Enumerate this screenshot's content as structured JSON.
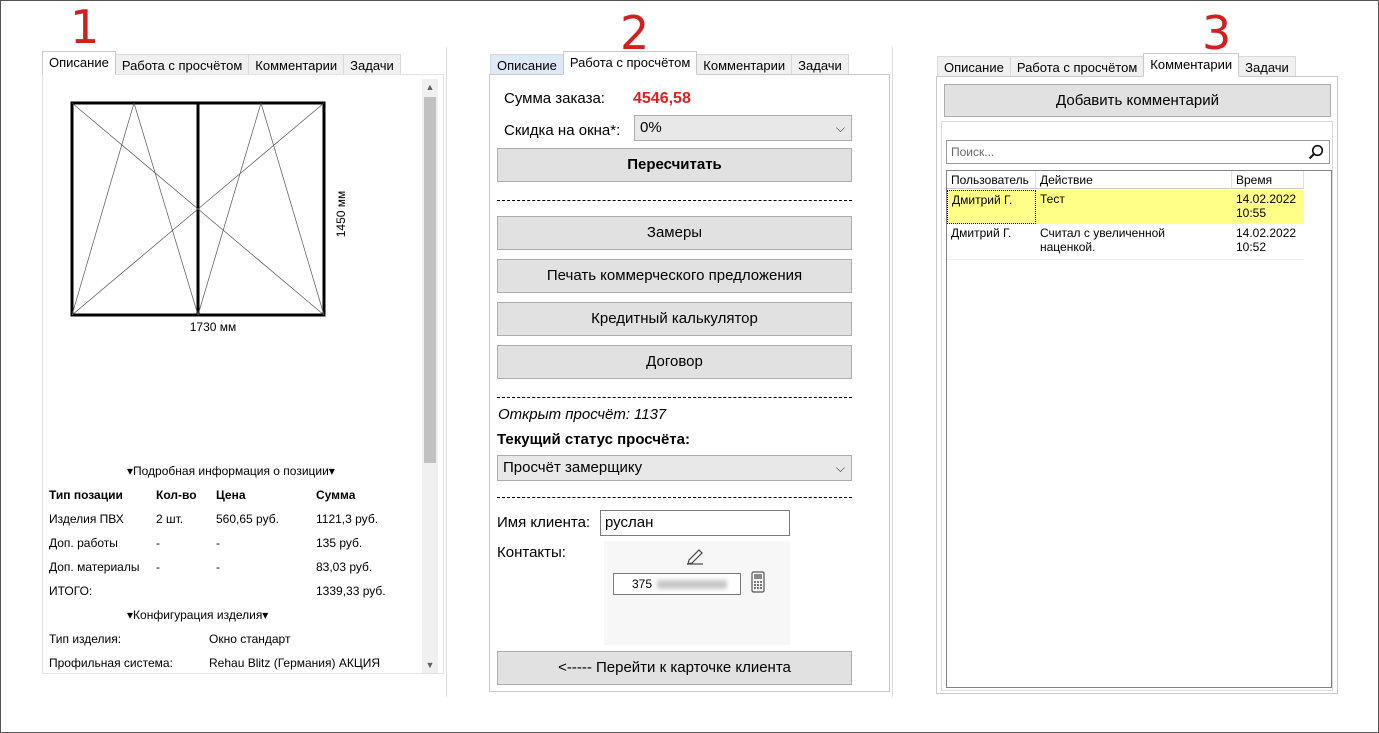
{
  "labels": {
    "one": "1",
    "two": "2",
    "three": "3"
  },
  "colors": {
    "accent": "#d21f1f",
    "selected_row": "#ffff88",
    "tab_blue": "#dde9f6"
  },
  "panel1": {
    "tabs": [
      "Описание",
      "Работа с просчётом",
      "Комментарии",
      "Задачи"
    ],
    "active_tab": 0,
    "drawing": {
      "height_label": "1450 мм",
      "width_label": "1730 мм"
    },
    "detail_header": "▾Подробная информация о позиции▾",
    "table_headers": [
      "Тип позации",
      "Кол-во",
      "Цена",
      "Сумма"
    ],
    "table_rows": [
      [
        "Изделия ПВХ",
        "2 шт.",
        "560,65 руб.",
        "1121,3 руб."
      ],
      [
        "Доп. работы",
        "-",
        "-",
        "135 руб."
      ],
      [
        "Доп. материалы",
        "-",
        "-",
        "83,03 руб."
      ],
      [
        "ИТОГО:",
        "",
        "",
        "1339,33 руб."
      ]
    ],
    "config_header": "▾Конфигурация изделия▾",
    "config_rows": [
      [
        "Тип изделия:",
        "Окно стандарт"
      ],
      [
        "Профильная система:",
        "Rehau Blitz (Германия) АКЦИЯ"
      ]
    ]
  },
  "panel2": {
    "tabs": [
      "Описание",
      "Работа с просчётом",
      "Комментарии",
      "Задачи"
    ],
    "active_tab": 1,
    "sum_label": "Сумма заказа:",
    "sum_value": "4546,58",
    "discount_label": "Скидка на окна*:",
    "discount_value": "0%",
    "recalc_button": "Пересчитать",
    "buttons": [
      "Замеры",
      "Печать коммерческого предложения",
      "Кредитный калькулятор",
      "Договор"
    ],
    "opened_label": "Открыт просчёт:",
    "opened_value": "1137",
    "status_label": "Текущий статус просчёта:",
    "status_value": "Просчёт замерщику",
    "client_label": "Имя клиента:",
    "client_value": "руслан",
    "contacts_label": "Контакты:",
    "phone_value": "375",
    "goto_button": "<----- Перейти к карточке клиента"
  },
  "panel3": {
    "tabs": [
      "Описание",
      "Работа с просчётом",
      "Комментарии",
      "Задачи"
    ],
    "active_tab": 2,
    "add_button": "Добавить комментарий",
    "search_placeholder": "Поиск...",
    "columns": [
      "Пользователь",
      "Действие",
      "Время"
    ],
    "rows": [
      {
        "user": "Дмитрий Г.",
        "action": "Тест",
        "time": "14.02.2022 10:55",
        "selected": true
      },
      {
        "user": "Дмитрий Г.",
        "action": "Считал с увеличенной наценкой.",
        "time": "14.02.2022 10:52",
        "selected": false
      }
    ]
  }
}
